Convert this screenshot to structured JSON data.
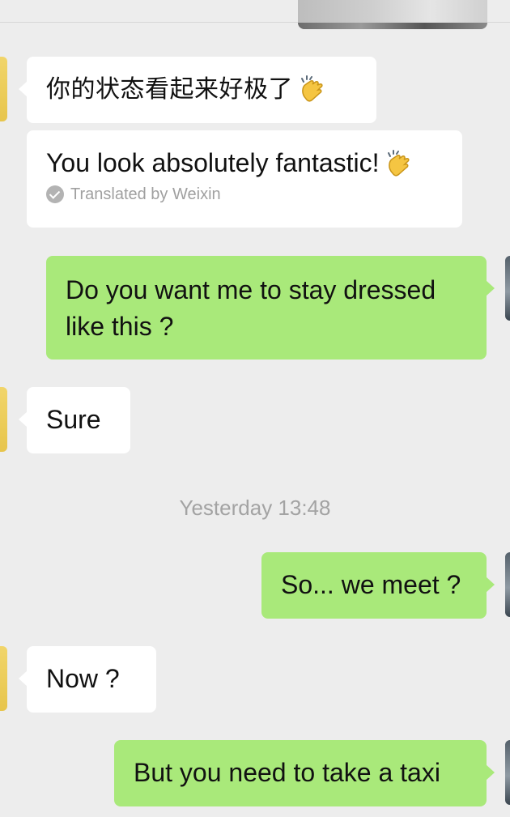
{
  "messages": [
    {
      "id": "m1",
      "side": "incoming",
      "text": "你的状态看起来好极了",
      "emoji": "clapping-hands-icon"
    },
    {
      "id": "m1t",
      "side": "incoming",
      "text": "You look absolutely fantastic!",
      "emoji": "clapping-hands-icon",
      "translation_label": "Translated by Weixin"
    },
    {
      "id": "m2",
      "side": "outgoing",
      "text": "Do you want me to stay dressed like this ?"
    },
    {
      "id": "m3",
      "side": "incoming",
      "text": "Sure"
    },
    {
      "id": "m4",
      "side": "outgoing",
      "text": "So... we meet ?"
    },
    {
      "id": "m5",
      "side": "incoming",
      "text": "Now ?"
    },
    {
      "id": "m6",
      "side": "outgoing",
      "text": "But you need to take a taxi"
    }
  ],
  "timestamp": "Yesterday 13:48",
  "colors": {
    "background": "#ededed",
    "incoming_bubble": "#ffffff",
    "outgoing_bubble": "#a9e97a",
    "meta_text": "#a3a3a3"
  }
}
